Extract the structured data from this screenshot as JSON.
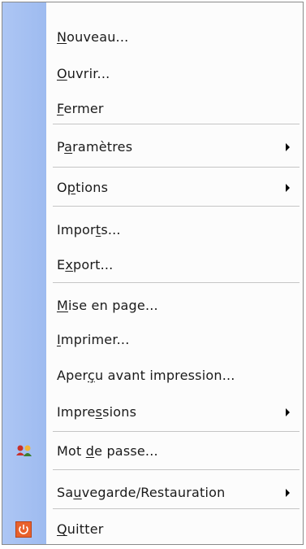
{
  "menu": {
    "items": [
      {
        "id": "nouveau",
        "pre": "",
        "acc": "N",
        "post": "ouveau...",
        "submenu": false
      },
      {
        "id": "ouvrir",
        "pre": "",
        "acc": "O",
        "post": "uvrir...",
        "submenu": false
      },
      {
        "id": "fermer",
        "pre": "",
        "acc": "F",
        "post": "ermer",
        "submenu": false
      },
      {
        "id": "parametres",
        "pre": "P",
        "acc": "a",
        "post": "ramètres",
        "submenu": true
      },
      {
        "id": "options",
        "pre": "O",
        "acc": "p",
        "post": "tions",
        "submenu": true
      },
      {
        "id": "imports",
        "pre": "Impor",
        "acc": "t",
        "post": "s...",
        "submenu": false
      },
      {
        "id": "export",
        "pre": "E",
        "acc": "x",
        "post": "port...",
        "submenu": false
      },
      {
        "id": "mise-en-page",
        "pre": "",
        "acc": "M",
        "post": "ise en page...",
        "submenu": false
      },
      {
        "id": "imprimer",
        "pre": "",
        "acc": "I",
        "post": "mprimer...",
        "submenu": false
      },
      {
        "id": "apercu",
        "pre": "Aper",
        "acc": "ç",
        "post": "u avant impression...",
        "submenu": false
      },
      {
        "id": "impressions",
        "pre": "Impre",
        "acc": "s",
        "post": "sions",
        "submenu": true
      },
      {
        "id": "mot-de-passe",
        "pre": "Mot ",
        "acc": "d",
        "post": "e passe...",
        "submenu": false,
        "icon": "users-icon"
      },
      {
        "id": "sauvegarde",
        "pre": "Sa",
        "acc": "u",
        "post": "vegarde/Restauration",
        "submenu": true
      },
      {
        "id": "quitter",
        "pre": "",
        "acc": "Q",
        "post": "uitter",
        "submenu": false,
        "icon": "power-icon"
      }
    ]
  }
}
